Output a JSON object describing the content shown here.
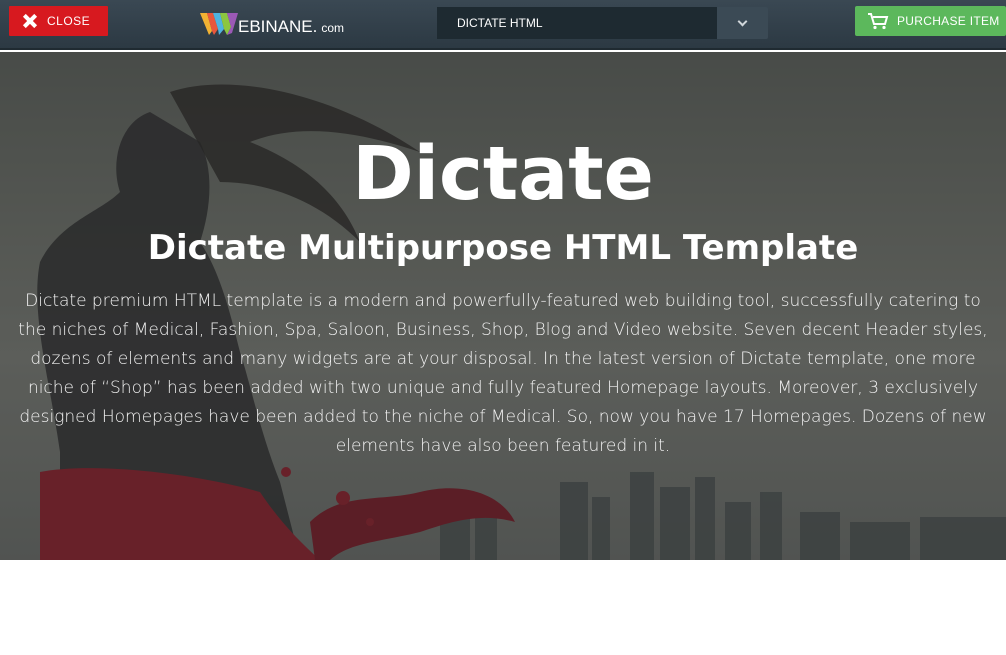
{
  "topbar": {
    "close_label": "CLOSE",
    "logo_text": "EBINANE.",
    "logo_suffix": "com",
    "selected_item": "DICTATE HTML",
    "purchase_label": "PURCHASE ITEM"
  },
  "hero": {
    "title": "Dictate",
    "subtitle": "Dictate Multipurpose HTML Template",
    "description": "Dictate premium HTML template is a modern and powerfully-featured web building tool, successfully catering to the niches of Medical, Fashion, Spa, Saloon, Business, Shop, Blog and Video website. Seven decent Header styles, dozens of elements and many widgets are at your disposal. In the latest version of Dictate template, one more niche of “Shop” has been added with two unique and fully featured Homepage layouts. Moreover, 3 exclusively designed Homepages have been added to the niche of Medical. So, now you have 17 Homepages. Dozens of new elements have also been featured in it."
  },
  "colors": {
    "close_red": "#d7191f",
    "purchase_green": "#5cb85c",
    "topbar_dark": "#2c3943"
  },
  "icons": [
    "close-icon",
    "webinane-logo-icon",
    "chevron-down-icon",
    "cart-icon"
  ]
}
